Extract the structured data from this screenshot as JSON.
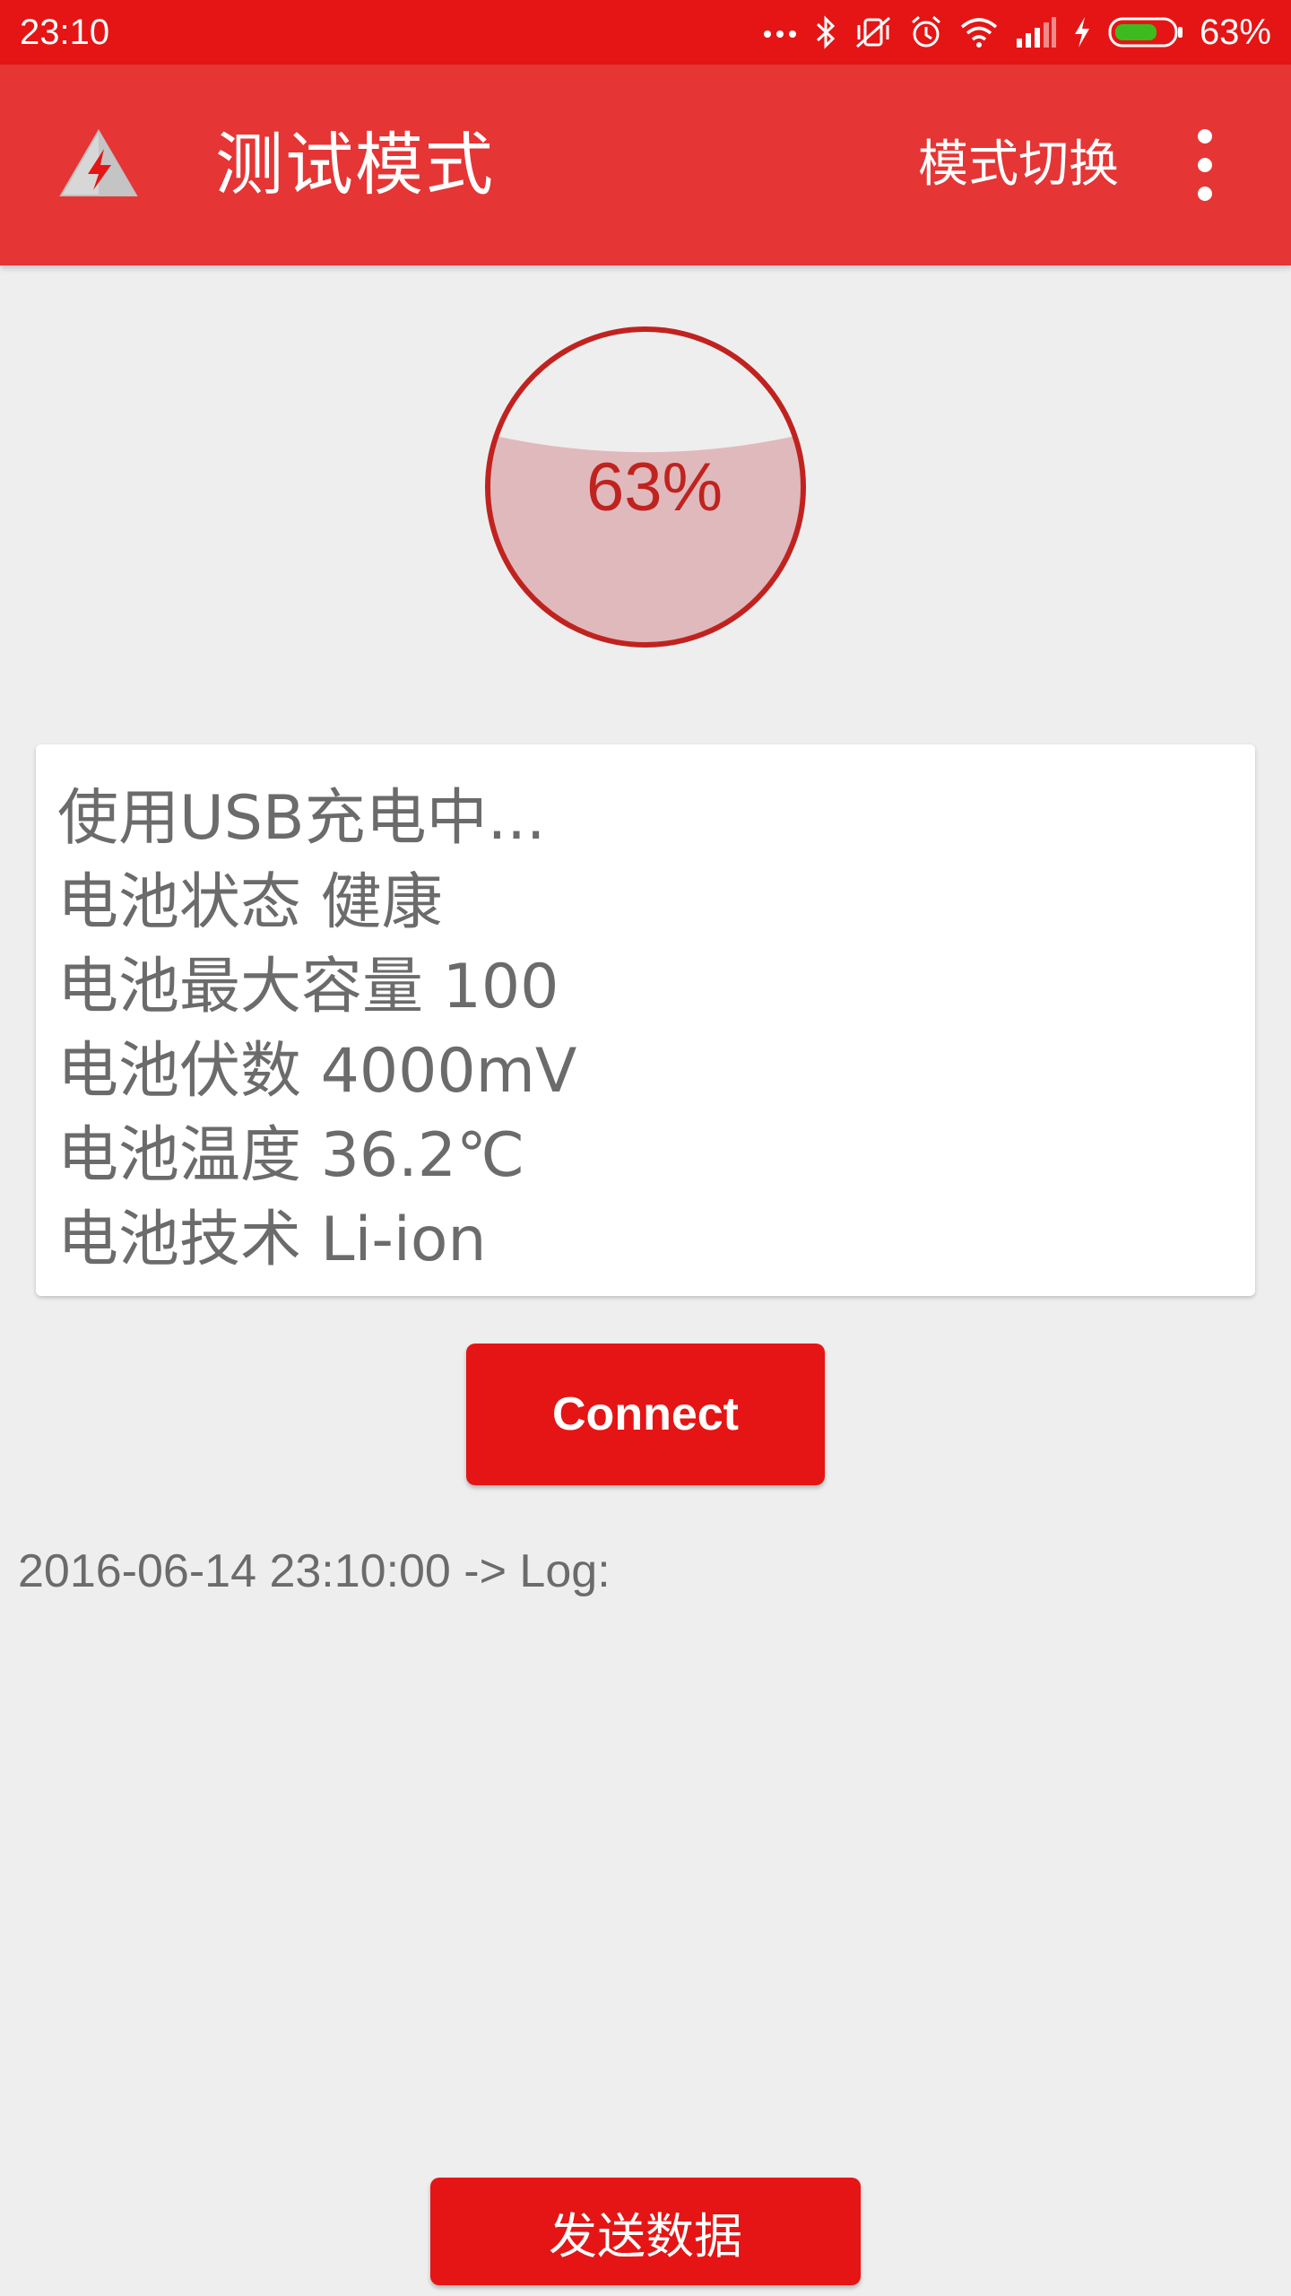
{
  "status_bar": {
    "time": "23:10",
    "battery_percent": "63%",
    "icons": [
      "more-dots-icon",
      "bluetooth-icon",
      "vibrate-off-icon",
      "alarm-icon",
      "wifi-icon",
      "signal-icon",
      "charging-bolt-icon",
      "battery-icon"
    ],
    "battery_fill_color": "#3dbb1e"
  },
  "toolbar": {
    "logo_icon": "lightning-warning-icon",
    "title": "测试模式",
    "mode_switch_label": "模式切换",
    "overflow_icon": "more-vertical-icon",
    "background_color": "#e53535"
  },
  "gauge": {
    "label": "63%",
    "level_fraction": 0.63,
    "ring_color": "#c0231f",
    "fill_color": "#e0b9bc"
  },
  "info": {
    "lines": [
      "使用USB充电中...",
      "电池状态 健康",
      "电池最大容量 100",
      "电池伏数 4000mV",
      "电池温度 36.2℃",
      "电池技术 Li-ion"
    ]
  },
  "connect_button": {
    "label": "Connect"
  },
  "log": {
    "text": "2016-06-14 23:10:00 -> Log:"
  },
  "send_button": {
    "label": "发送数据"
  },
  "accent_color": "#e51515"
}
